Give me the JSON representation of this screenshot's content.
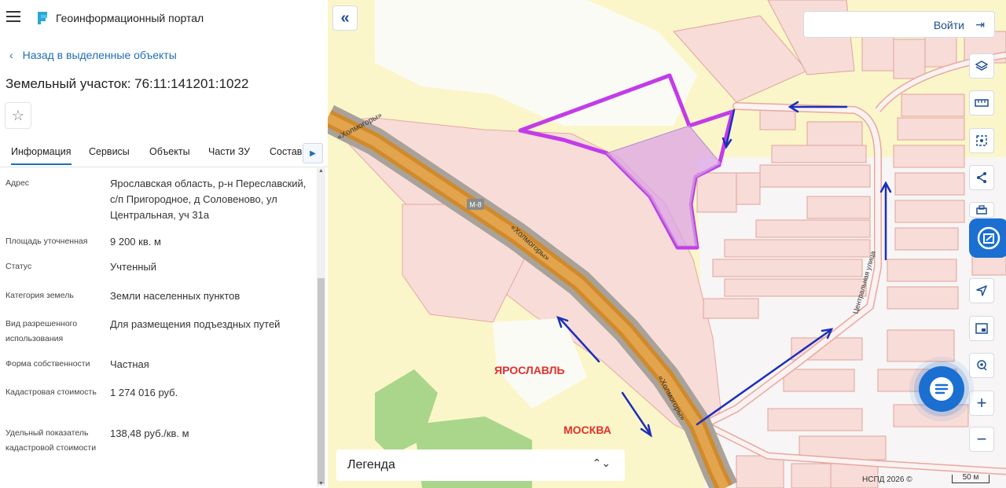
{
  "app": {
    "title": "Геоинформационный портал"
  },
  "nav": {
    "back_label": "Назад в выделенные объекты"
  },
  "object": {
    "title": "Земельный участок: 76:11:141201:1022"
  },
  "tabs": [
    {
      "label": "Информация",
      "active": true
    },
    {
      "label": "Сервисы"
    },
    {
      "label": "Объекты"
    },
    {
      "label": "Части ЗУ"
    },
    {
      "label": "Состав"
    }
  ],
  "info": [
    {
      "label": "Адрес",
      "value": "Ярославская область, р-н Переславский, с/п Пригородное, д Соловеново, ул Центральная, уч 31а"
    },
    {
      "label": "Площадь уточненная",
      "value": "9 200 кв. м"
    },
    {
      "label": "Статус",
      "value": "Учтенный"
    },
    {
      "label": "Категория земель",
      "value": "Земли населенных пунктов"
    },
    {
      "label": "Вид разрешенного использования",
      "value": "Для размещения подъездных путей"
    },
    {
      "label": "Форма собственности",
      "value": "Частная"
    },
    {
      "label": "Кадастровая стоимость",
      "value": "1 274 016 руб."
    },
    {
      "label": "Удельный показатель кадастровой стоимости",
      "value": "138,48 руб./кв. м"
    }
  ],
  "map": {
    "login_label": "Войти",
    "legend_label": "Легенда",
    "attribution": "НСПД 2026 ©",
    "scale": "50 м",
    "labels": {
      "city_yaroslavl": "ЯРОСЛАВЛЬ",
      "city_moscow": "МОСКВА",
      "road_holmogory_1": "«Холмогоры»",
      "road_holmogory_2": "«Холмогоры»",
      "road_holmogory_3": "«Холмогоры»",
      "road_shield": "M-8",
      "street_central": "Центральная улица"
    },
    "colors": {
      "parcel_outline": "#c23ce8",
      "arrows": "#1c2fb8",
      "city_labels": "#e0302a"
    }
  }
}
